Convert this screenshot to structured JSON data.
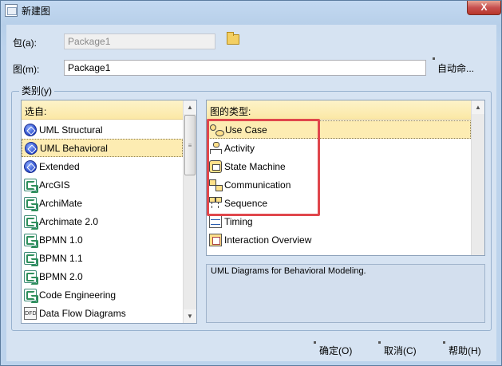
{
  "window": {
    "title": "新建图",
    "close_glyph": "X"
  },
  "form": {
    "package_label": "包(a):",
    "package_value": "Package1",
    "diagram_label": "图(m):",
    "diagram_value": "Package1",
    "auto_name_button": "自动命...",
    "category_group_label": "类别(y)"
  },
  "left_list": {
    "header": "选自:",
    "items": [
      {
        "label": "UML Structural",
        "icon": "uml-icon"
      },
      {
        "label": "UML Behavioral",
        "icon": "uml-icon",
        "selected": true
      },
      {
        "label": "Extended",
        "icon": "uml-icon"
      },
      {
        "label": "ArcGIS",
        "icon": "technology-icon"
      },
      {
        "label": "ArchiMate",
        "icon": "technology-icon"
      },
      {
        "label": "Archimate 2.0",
        "icon": "technology-icon"
      },
      {
        "label": "BPMN 1.0",
        "icon": "technology-icon"
      },
      {
        "label": "BPMN 1.1",
        "icon": "technology-icon"
      },
      {
        "label": "BPMN 2.0",
        "icon": "technology-icon"
      },
      {
        "label": "Code Engineering",
        "icon": "technology-icon"
      },
      {
        "label": "Data Flow Diagrams",
        "icon": "dfd-icon",
        "icon_text": "DFD"
      }
    ]
  },
  "right_list": {
    "header": "图的类型:",
    "items": [
      {
        "label": "Use Case",
        "icon": "use-case-icon",
        "selected": true
      },
      {
        "label": "Activity",
        "icon": "activity-icon"
      },
      {
        "label": "State Machine",
        "icon": "state-machine-icon"
      },
      {
        "label": "Communication",
        "icon": "communication-icon"
      },
      {
        "label": "Sequence",
        "icon": "sequence-icon"
      },
      {
        "label": "Timing",
        "icon": "timing-icon"
      },
      {
        "label": "Interaction Overview",
        "icon": "interaction-overview-icon"
      }
    ]
  },
  "description": "UML Diagrams for Behavioral Modeling.",
  "buttons": {
    "ok": "确定(O)",
    "cancel": "取消(C)",
    "help": "帮助(H)"
  },
  "colors": {
    "selection": "#fdecb2",
    "highlight_box": "#e0474c",
    "header_gradient": "#fbe8a6"
  }
}
